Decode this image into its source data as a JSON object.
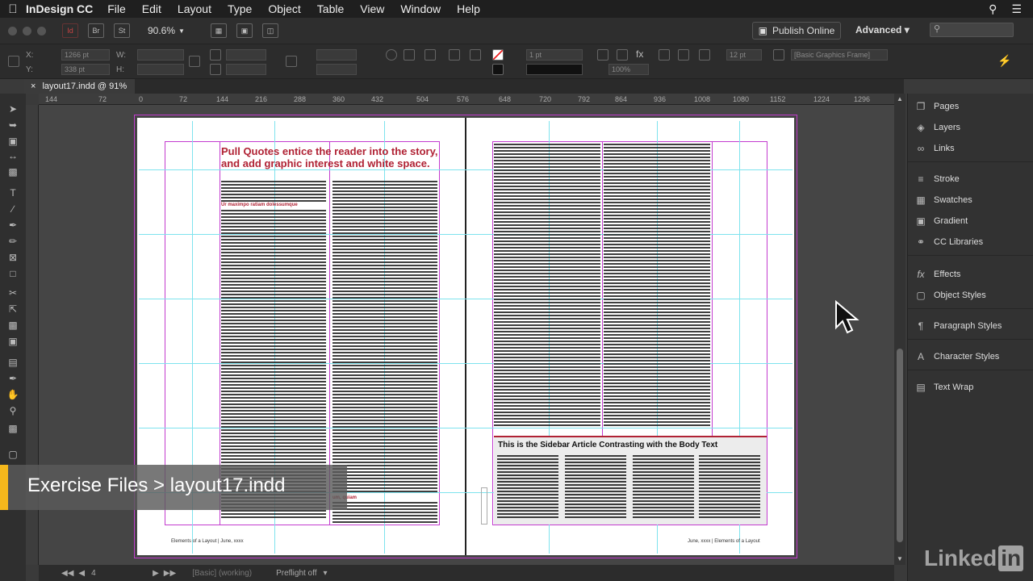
{
  "menubar": {
    "app_name": "InDesign CC",
    "items": [
      "File",
      "Edit",
      "Layout",
      "Type",
      "Object",
      "Table",
      "View",
      "Window",
      "Help"
    ]
  },
  "appbar": {
    "zoom": "90.6%",
    "publish_label": "Publish Online",
    "workspace": "Advanced",
    "btn_br": "Br",
    "btn_st": "St"
  },
  "control": {
    "x_label": "X:",
    "y_label": "Y:",
    "w_label": "W:",
    "h_label": "H:",
    "x_value": "1266 pt",
    "y_value": "338 pt",
    "stroke_weight": "1 pt",
    "opacity": "100%",
    "corner_size": "12 pt",
    "object_style": "[Basic Graphics Frame]"
  },
  "document": {
    "tab_title": "layout17.indd @ 91%",
    "ruler_ticks": [
      "144",
      "72",
      "0",
      "72",
      "144",
      "216",
      "288",
      "360",
      "432",
      "504",
      "576",
      "648",
      "720",
      "792",
      "864",
      "936",
      "1008",
      "1080",
      "1152",
      "1224",
      "1296"
    ],
    "pull_quote": "Pull Quotes entice the reader into the story, and add graphic interest and white space.",
    "sidebar_heading": "This is the Sidebar Article Contrasting with the Body Text",
    "subhead_1": "Ur maximpo ratiam dolessumque",
    "subhead_2": "um, quiam",
    "footer_left": "Elements of a Layout | June, xxxx",
    "footer_right": "June, xxxx | Elements of a Layout"
  },
  "panel": {
    "items": [
      {
        "label": "Pages",
        "icon": "pages-icon"
      },
      {
        "label": "Layers",
        "icon": "layers-icon"
      },
      {
        "label": "Links",
        "icon": "links-icon"
      },
      {
        "label": "Stroke",
        "icon": "stroke-icon"
      },
      {
        "label": "Swatches",
        "icon": "swatches-icon"
      },
      {
        "label": "Gradient",
        "icon": "gradient-icon"
      },
      {
        "label": "CC Libraries",
        "icon": "cc-libraries-icon"
      },
      {
        "label": "Effects",
        "icon": "effects-icon"
      },
      {
        "label": "Object Styles",
        "icon": "object-styles-icon"
      },
      {
        "label": "Paragraph Styles",
        "icon": "paragraph-styles-icon"
      },
      {
        "label": "Character Styles",
        "icon": "character-styles-icon"
      },
      {
        "label": "Text Wrap",
        "icon": "text-wrap-icon"
      }
    ]
  },
  "bottombar": {
    "page_number": "4",
    "preflight_profile": "[Basic] (working)",
    "preflight_status": "Preflight off"
  },
  "overlay": {
    "exercise_files": "Exercise Files > layout17.indd",
    "brand": "Linked",
    "brand_in": "in"
  },
  "colors": {
    "accent_red": "#b02234",
    "margin_magenta": "#c33ccf",
    "guide_cyan": "#7ee3ee",
    "overlay_yellow": "#f5b81c"
  }
}
